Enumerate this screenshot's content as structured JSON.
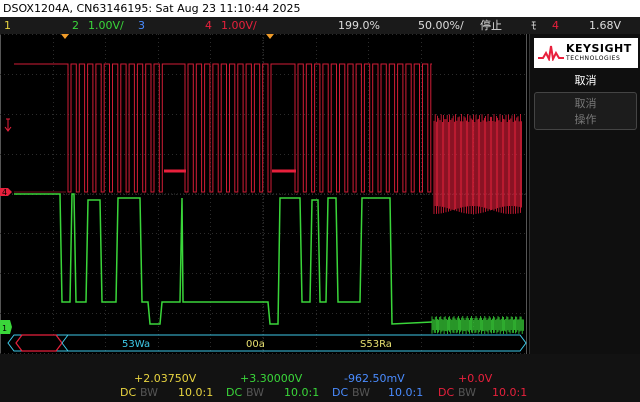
{
  "title": "DSOX1204A, CN63146195: Sat Aug 23 11:10:44 2025",
  "status": {
    "ch1_num": "1",
    "ch2_num": "2",
    "ch2_scale": "1.00V/",
    "ch3_num": "3",
    "ch4_num": "4",
    "ch4_scale": "1.00V/",
    "zoom": "199.0",
    "zoom_unit": "%",
    "position": "50.00%/",
    "run_state": "停止",
    "trig_channel": "4",
    "trig_level": "1.68V",
    "trig_icon": "falling-edge-icon"
  },
  "panel": {
    "brand": "KEYSIGHT",
    "sub": "TECHNOLOGIES",
    "menu_title": "取消",
    "softkey_line1": "取消",
    "softkey_line2": "操作"
  },
  "decode": {
    "items": [
      "53Wa",
      "00a",
      "S53Ra"
    ]
  },
  "markers": {
    "ch4": "4",
    "ch1": "1"
  },
  "channels": [
    {
      "offset": "+2.03750V",
      "coupling": "DC",
      "bw": "BW",
      "probe": "10.0:1",
      "color": "#e8d440"
    },
    {
      "offset": "+3.30000V",
      "coupling": "DC",
      "bw": "BW",
      "probe": "10.0:1",
      "color": "#3ad63a"
    },
    {
      "offset": "-962.50mV",
      "coupling": "DC",
      "bw": "BW",
      "probe": "10.0:1",
      "color": "#4a8cff"
    },
    {
      "offset": "+0.0V",
      "coupling": "DC",
      "bw": "BW",
      "probe": "10.0:1",
      "color": "#e8203c"
    }
  ],
  "colors": {
    "ch1": "#e8d440",
    "ch2": "#3ad63a",
    "ch3": "#4a8cff",
    "ch4": "#e8203c",
    "decode_text": "#3ec9e8",
    "decode_text_alt": "#e8e070"
  }
}
